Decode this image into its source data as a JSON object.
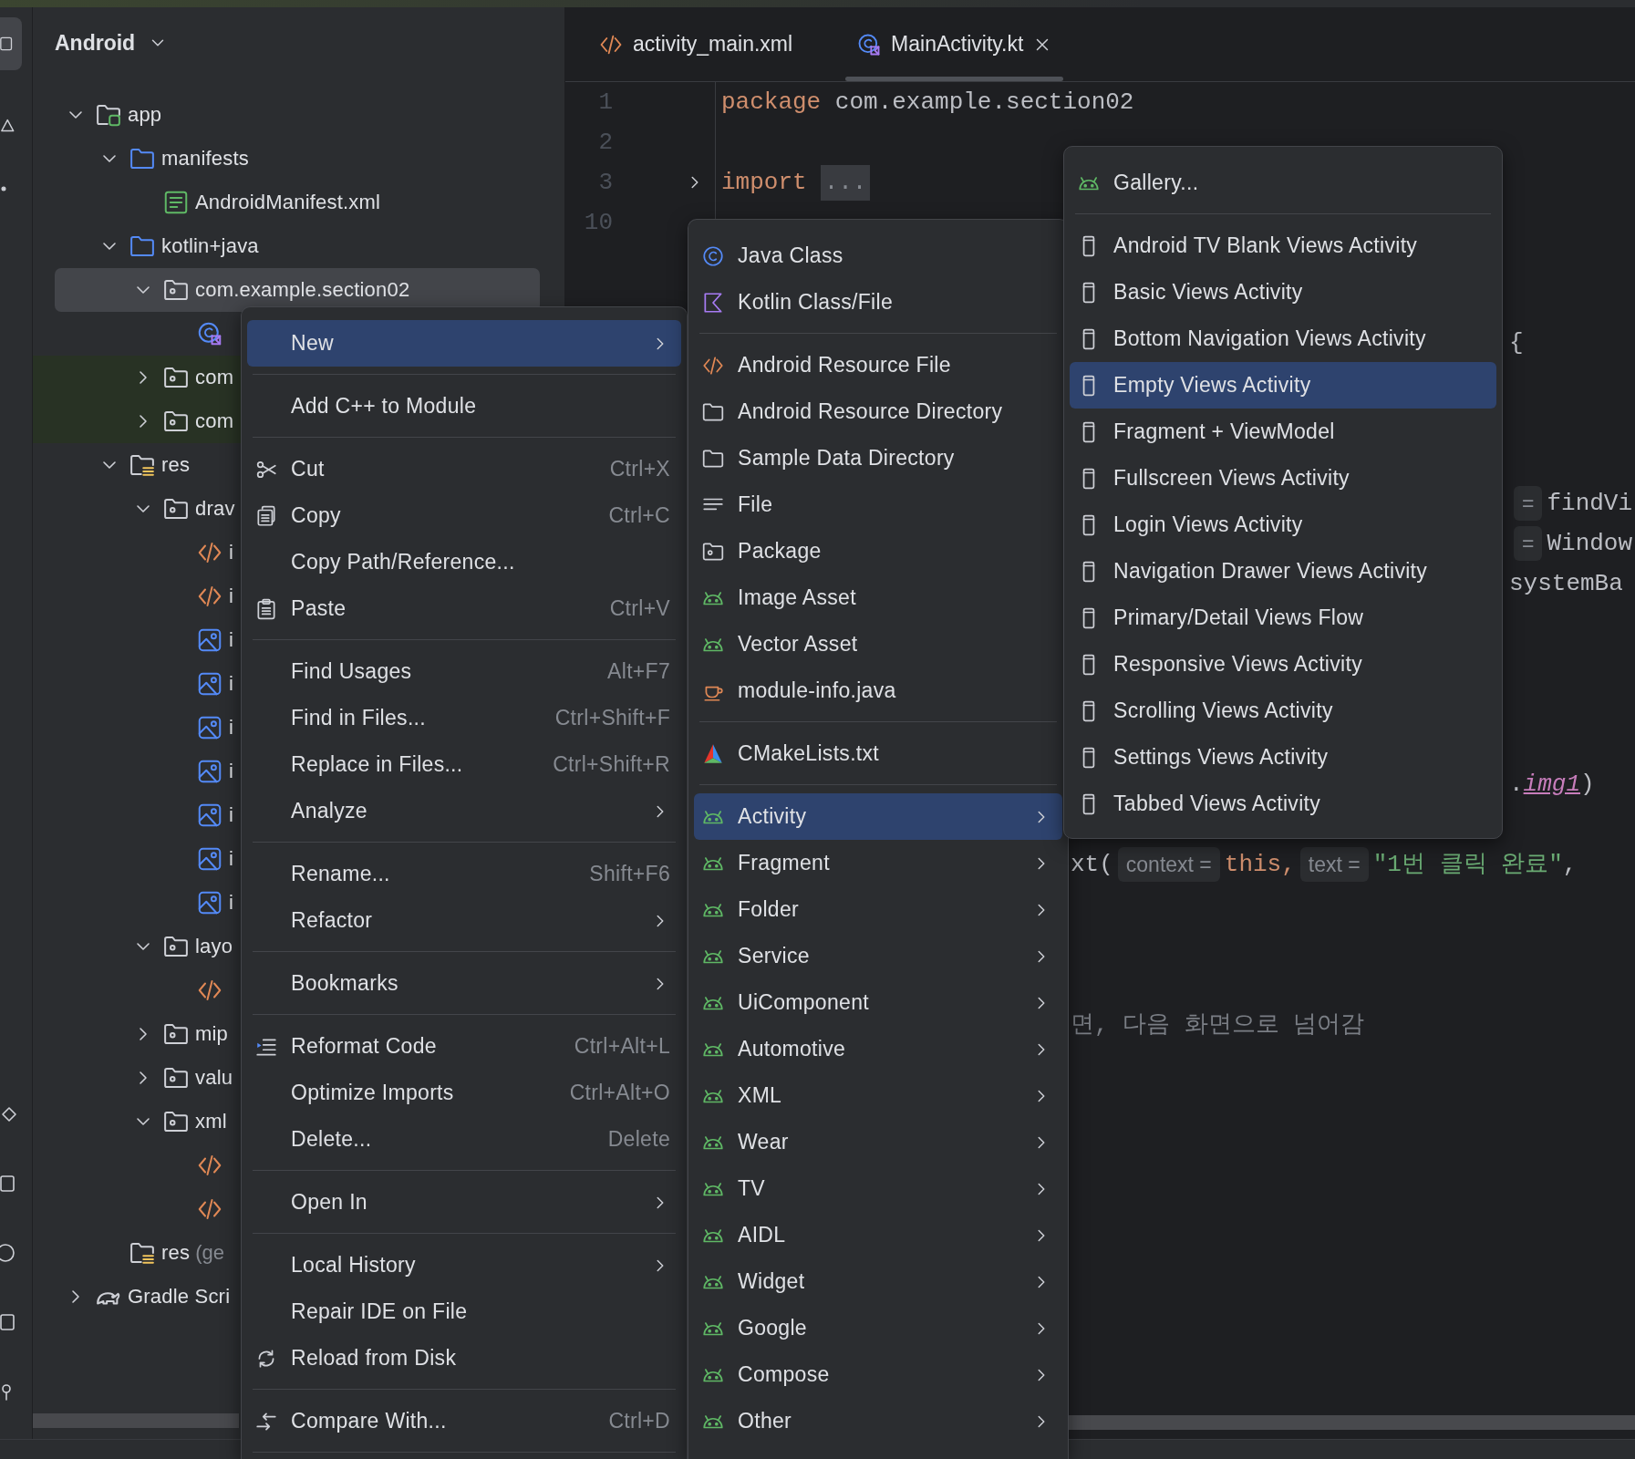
{
  "project_panel": {
    "title": "Android",
    "tree": [
      {
        "label": "app",
        "kind": "module",
        "expanded": true,
        "selected": false,
        "children": [
          {
            "label": "manifests",
            "kind": "source-folder",
            "expanded": true,
            "selected": false,
            "children": [
              {
                "label": "AndroidManifest.xml",
                "kind": "manifest",
                "selected": false
              }
            ]
          },
          {
            "label": "kotlin+java",
            "kind": "source-folder",
            "expanded": true,
            "selected": false,
            "children": [
              {
                "label": "com.example.section02",
                "kind": "package",
                "expanded": true,
                "selected": true,
                "highlighted": false,
                "children": [
                  {
                    "kind": "kotlin-class",
                    "selected": false
                  }
                ]
              },
              {
                "label": "com",
                "kind": "package",
                "expanded": false,
                "selected": false,
                "highlighted": true
              },
              {
                "label": "com",
                "kind": "package",
                "expanded": false,
                "selected": false,
                "highlighted": true
              }
            ]
          },
          {
            "label": "res",
            "kind": "res-folder",
            "expanded": true,
            "selected": false,
            "children": [
              {
                "label": "drav",
                "kind": "package",
                "expanded": true,
                "selected": false,
                "children": [
                  {
                    "label": "i",
                    "kind": "xml",
                    "selected": false
                  },
                  {
                    "label": "i",
                    "kind": "xml",
                    "selected": false
                  },
                  {
                    "label": "i",
                    "kind": "image",
                    "selected": false
                  },
                  {
                    "label": "i",
                    "kind": "image",
                    "selected": false
                  },
                  {
                    "label": "i",
                    "kind": "image",
                    "selected": false
                  },
                  {
                    "label": "i",
                    "kind": "image",
                    "selected": false
                  },
                  {
                    "label": "i",
                    "kind": "image",
                    "selected": false
                  },
                  {
                    "label": "i",
                    "kind": "image",
                    "selected": false
                  },
                  {
                    "label": "i",
                    "kind": "image",
                    "selected": false
                  }
                ]
              },
              {
                "label": "layo",
                "kind": "package",
                "expanded": true,
                "selected": false,
                "children": [
                  {
                    "kind": "xml",
                    "selected": false
                  }
                ]
              },
              {
                "label": "mip",
                "kind": "package",
                "expanded": false,
                "selected": false
              },
              {
                "label": "valu",
                "kind": "package",
                "expanded": false,
                "selected": false
              },
              {
                "label": "xml",
                "kind": "package",
                "expanded": true,
                "selected": false,
                "children": [
                  {
                    "kind": "xml",
                    "selected": false
                  },
                  {
                    "kind": "xml",
                    "selected": false
                  }
                ]
              }
            ]
          },
          {
            "label": "res",
            "note": "(ge",
            "kind": "res-folder",
            "selected": false
          }
        ]
      },
      {
        "label": "Gradle Scri",
        "kind": "gradle",
        "expanded": false,
        "selected": false
      }
    ]
  },
  "editor": {
    "tabs": [
      {
        "label": "activity_main.xml",
        "kind": "xml",
        "selected": false,
        "closable": false
      },
      {
        "label": "MainActivity.kt",
        "kind": "kotlin-class",
        "selected": true,
        "closable": true
      }
    ],
    "lines": [
      {
        "kind": "code",
        "number": "1",
        "tokens": [
          {
            "text": "package",
            "kind": "keyword"
          },
          {
            "text": " com.example.section02",
            "kind": "plain"
          }
        ]
      },
      {
        "kind": "code",
        "number": "2"
      },
      {
        "kind": "code",
        "number": "3",
        "expanded": false,
        "tokens": [
          {
            "text": "import",
            "kind": "keyword"
          },
          {
            "text": "...",
            "kind": "folded"
          }
        ]
      },
      {
        "kind": "code",
        "number": "10"
      },
      {
        "kind": "blank"
      },
      {
        "kind": "blank"
      },
      {
        "kind": "far",
        "tokens": [
          {
            "text": "{",
            "kind": "plain"
          }
        ]
      },
      {
        "kind": "blank"
      },
      {
        "kind": "blank"
      },
      {
        "kind": "blank"
      },
      {
        "kind": "far",
        "tokens": [
          {
            "text": "=",
            "kind": "hint"
          },
          {
            "text": "findVi",
            "kind": "plain"
          }
        ]
      },
      {
        "kind": "far",
        "tokens": [
          {
            "text": "=",
            "kind": "hint"
          },
          {
            "text": "Window",
            "kind": "plain"
          }
        ]
      },
      {
        "kind": "far",
        "tokens": [
          {
            "text": "systemBa",
            "kind": "plain"
          }
        ]
      },
      {
        "kind": "blank"
      },
      {
        "kind": "blank"
      },
      {
        "kind": "blank"
      },
      {
        "kind": "blank"
      },
      {
        "kind": "far",
        "tokens": [
          {
            "text": ".",
            "kind": "plain"
          },
          {
            "text": "img1",
            "kind": "field"
          },
          {
            "text": ")",
            "kind": "plain"
          }
        ]
      },
      {
        "kind": "blank"
      },
      {
        "kind": "near",
        "tokens": [
          {
            "text": "xt(",
            "kind": "plain"
          },
          {
            "text": "context =",
            "kind": "hint"
          },
          {
            "text": "this,",
            "kind": "keyword"
          },
          {
            "text": "text =",
            "kind": "hint"
          },
          {
            "text": "\"1번 클릭 완료\"",
            "kind": "string"
          },
          {
            "text": ",",
            "kind": "plain"
          }
        ]
      },
      {
        "kind": "blank"
      },
      {
        "kind": "blank"
      },
      {
        "kind": "blank"
      },
      {
        "kind": "near",
        "tokens": [
          {
            "text": "면, 다음 화면으로 넘어감",
            "kind": "comment"
          }
        ]
      }
    ]
  },
  "context_menu": {
    "items": [
      {
        "kind": "plain",
        "label": "New",
        "selected": true,
        "submenu": true
      },
      {
        "kind": "separator"
      },
      {
        "kind": "plain",
        "label": "Add C++ to Module",
        "selected": false,
        "submenu": false
      },
      {
        "kind": "separator"
      },
      {
        "kind": "scissors",
        "label": "Cut",
        "shortcut": "Ctrl+X",
        "selected": false,
        "submenu": false
      },
      {
        "kind": "copy",
        "label": "Copy",
        "shortcut": "Ctrl+C",
        "selected": false,
        "submenu": false
      },
      {
        "kind": "plain",
        "label": "Copy Path/Reference...",
        "selected": false,
        "submenu": false
      },
      {
        "kind": "paste",
        "label": "Paste",
        "shortcut": "Ctrl+V",
        "selected": false,
        "submenu": false
      },
      {
        "kind": "separator"
      },
      {
        "kind": "plain",
        "label": "Find Usages",
        "shortcut": "Alt+F7",
        "selected": false,
        "submenu": false
      },
      {
        "kind": "plain",
        "label": "Find in Files...",
        "shortcut": "Ctrl+Shift+F",
        "selected": false,
        "submenu": false
      },
      {
        "kind": "plain",
        "label": "Replace in Files...",
        "shortcut": "Ctrl+Shift+R",
        "selected": false,
        "submenu": false
      },
      {
        "kind": "plain",
        "label": "Analyze",
        "selected": false,
        "submenu": true
      },
      {
        "kind": "separator"
      },
      {
        "kind": "plain",
        "label": "Rename...",
        "shortcut": "Shift+F6",
        "selected": false,
        "submenu": false
      },
      {
        "kind": "plain",
        "label": "Refactor",
        "selected": false,
        "submenu": true
      },
      {
        "kind": "separator"
      },
      {
        "kind": "plain",
        "label": "Bookmarks",
        "selected": false,
        "submenu": true
      },
      {
        "kind": "separator"
      },
      {
        "kind": "reformat",
        "label": "Reformat Code",
        "shortcut": "Ctrl+Alt+L",
        "selected": false,
        "submenu": false
      },
      {
        "kind": "plain",
        "label": "Optimize Imports",
        "shortcut": "Ctrl+Alt+O",
        "selected": false,
        "submenu": false
      },
      {
        "kind": "plain",
        "label": "Delete...",
        "shortcut": "Delete",
        "selected": false,
        "submenu": false
      },
      {
        "kind": "separator"
      },
      {
        "kind": "plain",
        "label": "Open In",
        "selected": false,
        "submenu": true
      },
      {
        "kind": "separator"
      },
      {
        "kind": "plain",
        "label": "Local History",
        "selected": false,
        "submenu": true
      },
      {
        "kind": "plain",
        "label": "Repair IDE on File",
        "selected": false,
        "submenu": false
      },
      {
        "kind": "reload",
        "label": "Reload from Disk",
        "selected": false,
        "submenu": false
      },
      {
        "kind": "separator"
      },
      {
        "kind": "compare",
        "label": "Compare With...",
        "shortcut": "Ctrl+D",
        "selected": false,
        "submenu": false
      },
      {
        "kind": "separator"
      }
    ]
  },
  "new_menu": {
    "items": [
      {
        "kind": "java-class",
        "label": "Java Class",
        "selected": false,
        "submenu": false
      },
      {
        "kind": "kotlin-file",
        "label": "Kotlin Class/File",
        "selected": false,
        "submenu": false
      },
      {
        "kind": "separator"
      },
      {
        "kind": "xml",
        "label": "Android Resource File",
        "selected": false,
        "submenu": false
      },
      {
        "kind": "folder",
        "label": "Android Resource Directory",
        "selected": false,
        "submenu": false
      },
      {
        "kind": "folder",
        "label": "Sample Data Directory",
        "selected": false,
        "submenu": false
      },
      {
        "kind": "lines",
        "label": "File",
        "selected": false,
        "submenu": false
      },
      {
        "kind": "package",
        "label": "Package",
        "selected": false,
        "submenu": false
      },
      {
        "kind": "android",
        "label": "Image Asset",
        "selected": false,
        "submenu": false
      },
      {
        "kind": "android",
        "label": "Vector Asset",
        "selected": false,
        "submenu": false
      },
      {
        "kind": "cup",
        "label": "module-info.java",
        "selected": false,
        "submenu": false
      },
      {
        "kind": "separator"
      },
      {
        "kind": "cmake",
        "label": "CMakeLists.txt",
        "selected": false,
        "submenu": false
      },
      {
        "kind": "separator"
      },
      {
        "kind": "android",
        "label": "Activity",
        "selected": true,
        "submenu": true
      },
      {
        "kind": "android",
        "label": "Fragment",
        "selected": false,
        "submenu": true
      },
      {
        "kind": "android",
        "label": "Folder",
        "selected": false,
        "submenu": true
      },
      {
        "kind": "android",
        "label": "Service",
        "selected": false,
        "submenu": true
      },
      {
        "kind": "android",
        "label": "UiComponent",
        "selected": false,
        "submenu": true
      },
      {
        "kind": "android",
        "label": "Automotive",
        "selected": false,
        "submenu": true
      },
      {
        "kind": "android",
        "label": "XML",
        "selected": false,
        "submenu": true
      },
      {
        "kind": "android",
        "label": "Wear",
        "selected": false,
        "submenu": true
      },
      {
        "kind": "android",
        "label": "TV",
        "selected": false,
        "submenu": true
      },
      {
        "kind": "android",
        "label": "AIDL",
        "selected": false,
        "submenu": true
      },
      {
        "kind": "android",
        "label": "Widget",
        "selected": false,
        "submenu": true
      },
      {
        "kind": "android",
        "label": "Google",
        "selected": false,
        "submenu": true
      },
      {
        "kind": "android",
        "label": "Compose",
        "selected": false,
        "submenu": true
      },
      {
        "kind": "android",
        "label": "Other",
        "selected": false,
        "submenu": true
      }
    ]
  },
  "activity_menu": {
    "items": [
      {
        "kind": "android",
        "label": "Gallery...",
        "selected": false
      },
      {
        "kind": "separator"
      },
      {
        "kind": "phone",
        "label": "Android TV Blank Views Activity",
        "selected": false
      },
      {
        "kind": "phone",
        "label": "Basic Views Activity",
        "selected": false
      },
      {
        "kind": "phone",
        "label": "Bottom Navigation Views Activity",
        "selected": false
      },
      {
        "kind": "phone",
        "label": "Empty Views Activity",
        "selected": true
      },
      {
        "kind": "phone",
        "label": "Fragment + ViewModel",
        "selected": false
      },
      {
        "kind": "phone",
        "label": "Fullscreen Views Activity",
        "selected": false
      },
      {
        "kind": "phone",
        "label": "Login Views Activity",
        "selected": false
      },
      {
        "kind": "phone",
        "label": "Navigation Drawer Views Activity",
        "selected": false
      },
      {
        "kind": "phone",
        "label": "Primary/Detail Views Flow",
        "selected": false
      },
      {
        "kind": "phone",
        "label": "Responsive Views Activity",
        "selected": false
      },
      {
        "kind": "phone",
        "label": "Scrolling Views Activity",
        "selected": false
      },
      {
        "kind": "phone",
        "label": "Settings Views Activity",
        "selected": false
      },
      {
        "kind": "phone",
        "label": "Tabbed Views Activity",
        "selected": false
      }
    ]
  }
}
